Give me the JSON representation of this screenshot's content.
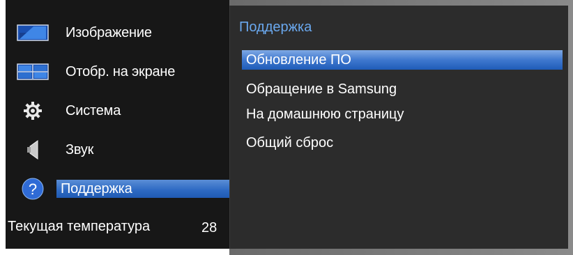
{
  "main_menu": {
    "items": [
      {
        "label": "Изображение",
        "icon": "picture-icon",
        "selected": false
      },
      {
        "label": "Отобр. на экране",
        "icon": "onscreen-display-icon",
        "selected": false
      },
      {
        "label": "Система",
        "icon": "gear-icon",
        "selected": false
      },
      {
        "label": "Звук",
        "icon": "speaker-icon",
        "selected": false
      },
      {
        "label": "Поддержка",
        "icon": "help-question-icon",
        "selected": true
      }
    ],
    "temperature": {
      "label": "Текущая температура",
      "value": "28"
    }
  },
  "sub_menu": {
    "title": "Поддержка",
    "items": [
      {
        "label": "Обновление ПО",
        "selected": true
      },
      {
        "label": "Обращение в Samsung",
        "selected": false
      },
      {
        "label": "На домашнюю страницу",
        "selected": false
      },
      {
        "label": "Общий сброс",
        "selected": false
      }
    ]
  },
  "colors": {
    "panel_dark": "#171717",
    "panel_sub": "#2c2c2c",
    "accent": "#2f6bc4",
    "title_blue": "#6aa8ee"
  }
}
